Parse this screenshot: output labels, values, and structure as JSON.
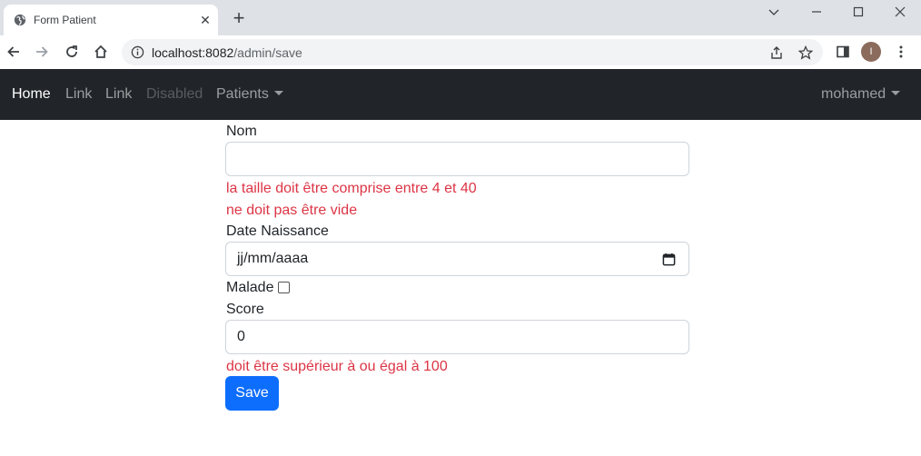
{
  "browser": {
    "tab_title": "Form Patient",
    "url_host": "localhost:8082",
    "url_path": "/admin/save",
    "profile_initial": "I"
  },
  "navbar": {
    "links": [
      "Home",
      "Link",
      "Link",
      "Disabled"
    ],
    "dropdown_label": "Patients",
    "user_label": "mohamed"
  },
  "form": {
    "nom_label": "Nom",
    "nom_value": "",
    "nom_errors": [
      "la taille doit être comprise entre 4 et 40",
      "ne doit pas être vide"
    ],
    "date_label": "Date Naissance",
    "date_placeholder": "jj/mm/aaaa",
    "malade_label": "Malade",
    "malade_checked": false,
    "score_label": "Score",
    "score_value": "0",
    "score_error": "doit être supérieur à ou égal à 100",
    "save_label": "Save"
  },
  "colors": {
    "navbar_bg": "#212529",
    "error": "#dc3545",
    "primary": "#0d6efd"
  }
}
